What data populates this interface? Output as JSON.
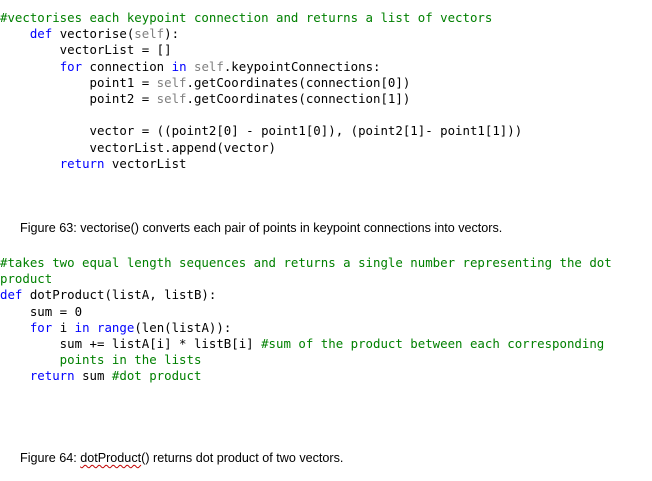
{
  "block1": {
    "lines": [
      [
        {
          "t": "#vectorises each keypoint connection and returns a list of vectors",
          "c": "cmt"
        }
      ],
      [
        {
          "t": "    "
        },
        {
          "t": "def",
          "c": "kw"
        },
        {
          "t": " vectorise("
        },
        {
          "t": "self",
          "c": "slf"
        },
        {
          "t": "):"
        }
      ],
      [
        {
          "t": "        vectorList = []"
        }
      ],
      [
        {
          "t": "        "
        },
        {
          "t": "for",
          "c": "kw"
        },
        {
          "t": " connection "
        },
        {
          "t": "in",
          "c": "kw"
        },
        {
          "t": " "
        },
        {
          "t": "self",
          "c": "slf"
        },
        {
          "t": ".keypointConnections:"
        }
      ],
      [
        {
          "t": "            point1 = "
        },
        {
          "t": "self",
          "c": "slf"
        },
        {
          "t": ".getCoordinates(connection[0])"
        }
      ],
      [
        {
          "t": "            point2 = "
        },
        {
          "t": "self",
          "c": "slf"
        },
        {
          "t": ".getCoordinates(connection[1])"
        }
      ],
      [],
      [
        {
          "t": "            vector = ((point2[0] - point1[0]), (point2[1]- point1[1]))"
        }
      ],
      [
        {
          "t": "            vectorList.append(vector)"
        }
      ],
      [
        {
          "t": "        "
        },
        {
          "t": "return",
          "c": "kw"
        },
        {
          "t": " vectorList"
        }
      ]
    ]
  },
  "caption1": "Figure 63: vectorise()  converts each pair of points in keypoint connections into vectors.",
  "block2": {
    "lines": [
      [
        {
          "t": "#takes two equal length sequences and returns a single number representing the dot",
          "c": "cmt"
        }
      ],
      [
        {
          "t": "product",
          "c": "cmt"
        }
      ],
      [
        {
          "t": "def",
          "c": "kw"
        },
        {
          "t": " dotProduct(listA, listB):"
        }
      ],
      [
        {
          "t": "    sum = 0"
        }
      ],
      [
        {
          "t": "    "
        },
        {
          "t": "for",
          "c": "kw"
        },
        {
          "t": " i "
        },
        {
          "t": "in",
          "c": "kw"
        },
        {
          "t": " "
        },
        {
          "t": "range",
          "c": "kw"
        },
        {
          "t": "(len(listA)):"
        }
      ],
      [
        {
          "t": "        sum += listA[i] * listB[i] "
        },
        {
          "t": "#sum of the product between each corresponding",
          "c": "cmt"
        }
      ],
      [
        {
          "t": "        points in the lists",
          "c": "cmt"
        }
      ],
      [
        {
          "t": "    "
        },
        {
          "t": "return",
          "c": "kw"
        },
        {
          "t": " sum "
        },
        {
          "t": "#dot product",
          "c": "cmt"
        }
      ]
    ]
  },
  "caption2": {
    "prefix": "Figure 64: ",
    "func": "dotProduct",
    "suffix": "()  returns dot product of two vectors."
  }
}
